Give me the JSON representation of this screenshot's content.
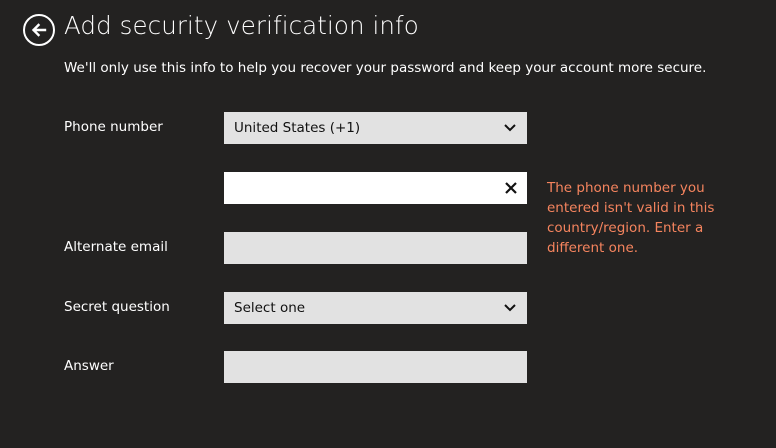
{
  "header": {
    "title": "Add security verification info",
    "back_icon": "back-arrow-icon"
  },
  "subtitle": "We'll only use this info to help you recover your password and keep your account more secure.",
  "form": {
    "phone_label": "Phone number",
    "country_selected": "United States (+1)",
    "phone_value": "",
    "phone_error": "The phone number you entered isn't valid in this country/region. Enter a different one.",
    "alternate_email_label": "Alternate email",
    "alternate_email_value": "",
    "secret_question_label": "Secret question",
    "secret_question_selected": "Select one",
    "answer_label": "Answer",
    "answer_value": ""
  },
  "colors": {
    "background": "#232221",
    "input_fill": "#e2e2e2",
    "active_input": "#ffffff",
    "error": "#f5845e"
  }
}
